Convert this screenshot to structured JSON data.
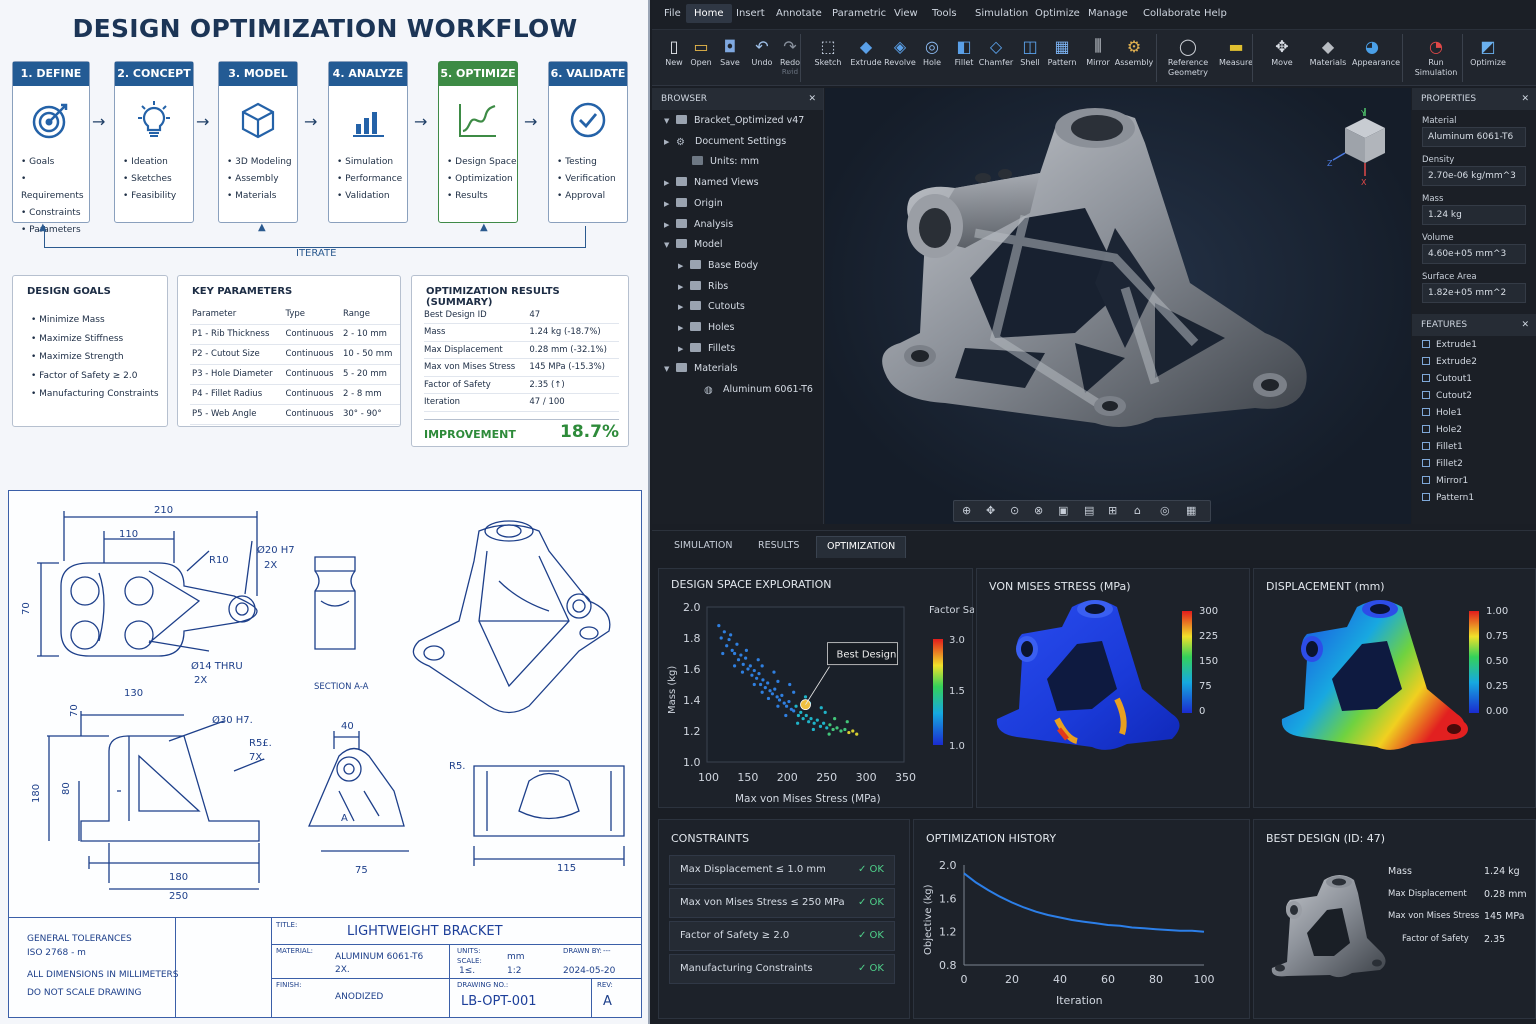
{
  "workflow": {
    "title": "DESIGN OPTIMIZATION WORKFLOW",
    "steps": [
      {
        "label": "1. DEFINE",
        "items": [
          "Goals",
          "Requirements",
          "Constraints",
          "Parameters"
        ]
      },
      {
        "label": "2. CONCEPT",
        "items": [
          "Ideation",
          "Sketches",
          "Feasibility"
        ]
      },
      {
        "label": "3. MODEL",
        "items": [
          "3D Modeling",
          "Assembly",
          "Materials"
        ]
      },
      {
        "label": "4. ANALYZE",
        "items": [
          "Simulation",
          "Performance",
          "Validation"
        ]
      },
      {
        "label": "5. OPTIMIZE",
        "items": [
          "Design Space",
          "Optimization",
          "Results"
        ]
      },
      {
        "label": "6. VALIDATE",
        "items": [
          "Testing",
          "Verification",
          "Approval"
        ]
      }
    ],
    "iterate": "ITERATE"
  },
  "goals": {
    "title": "DESIGN GOALS",
    "items": [
      "Minimize Mass",
      "Maximize Stiffness",
      "Maximize Strength",
      "Factor of Safety ≥ 2.0",
      "Manufacturing Constraints"
    ]
  },
  "params": {
    "title": "KEY PARAMETERS",
    "headers": [
      "Parameter",
      "Type",
      "Range"
    ],
    "rows": [
      [
        "P1 - Rib Thickness",
        "Continuous",
        "2 - 10 mm"
      ],
      [
        "P2 - Cutout Size",
        "Continuous",
        "10 - 50 mm"
      ],
      [
        "P3 - Hole Diameter",
        "Continuous",
        "5 - 20 mm"
      ],
      [
        "P4 - Fillet Radius",
        "Continuous",
        "2 - 8 mm"
      ],
      [
        "P5 - Web Angle",
        "Continuous",
        "30° - 90°"
      ]
    ]
  },
  "results": {
    "title": "OPTIMIZATION RESULTS (SUMMARY)",
    "rows": [
      [
        "Best Design ID",
        "47"
      ],
      [
        "Mass",
        "1.24 kg (-18.7%)"
      ],
      [
        "Max Displacement",
        "0.28 mm (-32.1%)"
      ],
      [
        "Max von Mises Stress",
        "145 MPa (-15.3%)"
      ],
      [
        "Factor of Safety",
        "2.35 (↑)"
      ],
      [
        "Iteration",
        "47 / 100"
      ]
    ],
    "improvement_label": "IMPROVEMENT",
    "improvement_value": "18.7%"
  },
  "drawing": {
    "dims": [
      "210",
      "110",
      "R10",
      "Ø20 H7",
      "2X",
      "70",
      "Ø14 THRU",
      "2X",
      "SECTION A-A",
      "130",
      "70",
      "Ø30 H7.",
      "R5£.",
      "7X.",
      "40",
      "R5.",
      "180",
      "80",
      "180",
      "250",
      "75",
      "115",
      "A"
    ],
    "tolerances": [
      "GENERAL TOLERANCES",
      "ISO 2768 - m",
      "ALL DIMENSIONS IN MILLIMETERS",
      "DO NOT SCALE DRAWING"
    ],
    "title_label": "TITLE:",
    "title": "LIGHTWEIGHT BRACKET",
    "material_label": "MATERIAL:",
    "material": "ALUMINUM 6061-T6",
    "material_note": "2X.",
    "units_label": "UNITS:",
    "units": "mm",
    "scale_label": "SCALE:",
    "scale_note": "1≤.",
    "scale": "1:2",
    "drawn_label": "DRAWN BY:",
    "drawn": "---",
    "date": "2024-05-20",
    "finish_label": "FINISH:",
    "finish": "ANODIZED",
    "dwg_label": "DRAWING NO.:",
    "dwg": "LB-OPT-001",
    "rev_label": "REV:",
    "rev": "A"
  },
  "menu": [
    "File",
    "Home",
    "Insert",
    "Annotate",
    "Parametric",
    "View",
    "Tools",
    "Simulation",
    "Optimize",
    "Manage",
    "Collaborate",
    "Help"
  ],
  "tools": [
    "New",
    "Open",
    "Save",
    "Undo",
    "Redo",
    "Sketch",
    "Extrude",
    "Revolve",
    "Hole",
    "Fillet",
    "Chamfer",
    "Shell",
    "Pattern",
    "Mirror",
    "Assembly",
    "Reference Geometry",
    "Measure",
    "Move",
    "Materials",
    "Appearance",
    "Run Simulation",
    "Optimize"
  ],
  "redo_sub": "Rשid",
  "browser": {
    "title": "BROWSER",
    "items": [
      "Bracket_Optimized v47",
      "Document Settings",
      "Units: mm",
      "Named Views",
      "Origin",
      "Analysis",
      "Model",
      "Base Body",
      "Ribs",
      "Cutouts",
      "Holes",
      "Fillets",
      "Materials",
      "Aluminum 6061-T6"
    ]
  },
  "view_cube": {
    "x": "X",
    "y": "Y",
    "z": "Z"
  },
  "properties": {
    "title": "PROPERTIES",
    "fields": [
      [
        "Material",
        "Aluminum 6061-T6"
      ],
      [
        "Density",
        "2.70e-06 kg/mm^3"
      ],
      [
        "Mass",
        "1.24 kg"
      ],
      [
        "Volume",
        "4.60e+05 mm^3"
      ],
      [
        "Surface Area",
        "1.82e+05 mm^2"
      ]
    ]
  },
  "features": {
    "title": "FEATURES",
    "items": [
      "Extrude1",
      "Extrude2",
      "Cutout1",
      "Cutout2",
      "Hole1",
      "Hole2",
      "Fillet1",
      "Fillet2",
      "Mirror1",
      "Pattern1"
    ]
  },
  "tabs": [
    "SIMULATION",
    "RESULTS",
    "OPTIMIZATION"
  ],
  "colors": {
    "accent": "#235b94",
    "ok": "#4fd08a",
    "improve": "#2e8b3a"
  },
  "chart_data": [
    {
      "type": "scatter",
      "title": "DESIGN SPACE EXPLORATION",
      "xlabel": "Max von Mises Stress (MPa)",
      "ylabel": "Mass (kg)",
      "xlim": [
        100,
        350
      ],
      "ylim": [
        1.0,
        2.0
      ],
      "xticks": [
        "100",
        "150",
        "200",
        "250",
        "300",
        "350"
      ],
      "yticks": [
        "2.0",
        "1.8",
        "1.6",
        "1.4",
        "1.2",
        "1.0"
      ],
      "colorbar": {
        "label": "Factor Safety",
        "ticks": [
          "3.0",
          "1.5",
          "1.0"
        ]
      },
      "annotation": "Best Design",
      "best": {
        "x": 225,
        "y": 1.37
      },
      "points": [
        [
          115,
          1.88
        ],
        [
          118,
          1.8
        ],
        [
          122,
          1.84
        ],
        [
          125,
          1.75
        ],
        [
          128,
          1.79
        ],
        [
          132,
          1.72
        ],
        [
          135,
          1.7
        ],
        [
          138,
          1.76
        ],
        [
          140,
          1.66
        ],
        [
          143,
          1.69
        ],
        [
          146,
          1.63
        ],
        [
          149,
          1.67
        ],
        [
          152,
          1.6
        ],
        [
          155,
          1.62
        ],
        [
          157,
          1.56
        ],
        [
          160,
          1.59
        ],
        [
          163,
          1.54
        ],
        [
          166,
          1.57
        ],
        [
          168,
          1.5
        ],
        [
          171,
          1.53
        ],
        [
          174,
          1.48
        ],
        [
          177,
          1.51
        ],
        [
          180,
          1.46
        ],
        [
          183,
          1.44
        ],
        [
          186,
          1.47
        ],
        [
          189,
          1.42
        ],
        [
          192,
          1.4
        ],
        [
          195,
          1.43
        ],
        [
          198,
          1.38
        ],
        [
          201,
          1.36
        ],
        [
          204,
          1.39
        ],
        [
          207,
          1.34
        ],
        [
          210,
          1.33
        ],
        [
          213,
          1.36
        ],
        [
          216,
          1.3
        ],
        [
          219,
          1.32
        ],
        [
          222,
          1.28
        ],
        [
          226,
          1.3
        ],
        [
          229,
          1.26
        ],
        [
          232,
          1.28
        ],
        [
          236,
          1.25
        ],
        [
          240,
          1.27
        ],
        [
          244,
          1.23
        ],
        [
          248,
          1.25
        ],
        [
          252,
          1.22
        ],
        [
          256,
          1.24
        ],
        [
          260,
          1.21
        ],
        [
          265,
          1.22
        ],
        [
          270,
          1.2
        ],
        [
          275,
          1.21
        ],
        [
          280,
          1.19
        ],
        [
          285,
          1.2
        ],
        [
          290,
          1.18
        ],
        [
          130,
          1.82
        ],
        [
          150,
          1.72
        ],
        [
          170,
          1.62
        ],
        [
          190,
          1.52
        ],
        [
          210,
          1.45
        ],
        [
          230,
          1.38
        ],
        [
          250,
          1.32
        ],
        [
          170,
          1.45
        ],
        [
          190,
          1.36
        ],
        [
          200,
          1.3
        ],
        [
          215,
          1.25
        ],
        [
          235,
          1.21
        ],
        [
          255,
          1.18
        ],
        [
          145,
          1.58
        ],
        [
          160,
          1.5
        ],
        [
          178,
          1.41
        ],
        [
          120,
          1.7
        ],
        [
          135,
          1.62
        ],
        [
          165,
          1.66
        ],
        [
          185,
          1.58
        ],
        [
          205,
          1.5
        ],
        [
          225,
          1.42
        ],
        [
          245,
          1.35
        ],
        [
          262,
          1.28
        ],
        [
          278,
          1.26
        ]
      ]
    },
    {
      "type": "line",
      "title": "OPTIMIZATION HISTORY",
      "xlabel": "Iteration",
      "ylabel": "Objective (kg)",
      "xlim": [
        0,
        100
      ],
      "ylim": [
        0.8,
        2.0
      ],
      "xticks": [
        "0",
        "20",
        "40",
        "60",
        "80",
        "100"
      ],
      "yticks": [
        "2.0",
        "1.6",
        "1.2",
        "0.8"
      ],
      "x": [
        0,
        5,
        10,
        15,
        20,
        25,
        30,
        35,
        40,
        45,
        50,
        55,
        60,
        65,
        70,
        75,
        80,
        85,
        90,
        95,
        100
      ],
      "values": [
        1.9,
        1.79,
        1.7,
        1.62,
        1.55,
        1.49,
        1.44,
        1.4,
        1.37,
        1.34,
        1.32,
        1.3,
        1.28,
        1.27,
        1.25,
        1.24,
        1.23,
        1.22,
        1.21,
        1.21,
        1.2
      ]
    }
  ],
  "stress": {
    "title": "VON MISES STRESS (MPa)",
    "ticks": [
      "300",
      "225",
      "150",
      "75",
      "0"
    ]
  },
  "disp": {
    "title": "DISPLACEMENT (mm)",
    "ticks": [
      "1.00",
      "0.75",
      "0.50",
      "0.25",
      "0.00"
    ]
  },
  "constraints": {
    "title": "CONSTRAINTS",
    "items": [
      [
        "Max Displacement ≤ 1.0 mm",
        "✓ OK"
      ],
      [
        "Max von Mises Stress ≤ 250 MPa",
        "✓ OK"
      ],
      [
        "Factor of Safety ≥ 2.0",
        "✓ OK"
      ],
      [
        "Manufacturing Constraints",
        "✓ OK"
      ]
    ]
  },
  "best": {
    "title": "BEST DESIGN (ID: 47)",
    "rows": [
      [
        "Mass",
        "1.24 kg"
      ],
      [
        "Max Displacement",
        "0.28 mm"
      ],
      [
        "Max von Mises Stress",
        "145 MPa"
      ],
      [
        "Factor of Safety",
        "2.35"
      ]
    ]
  }
}
